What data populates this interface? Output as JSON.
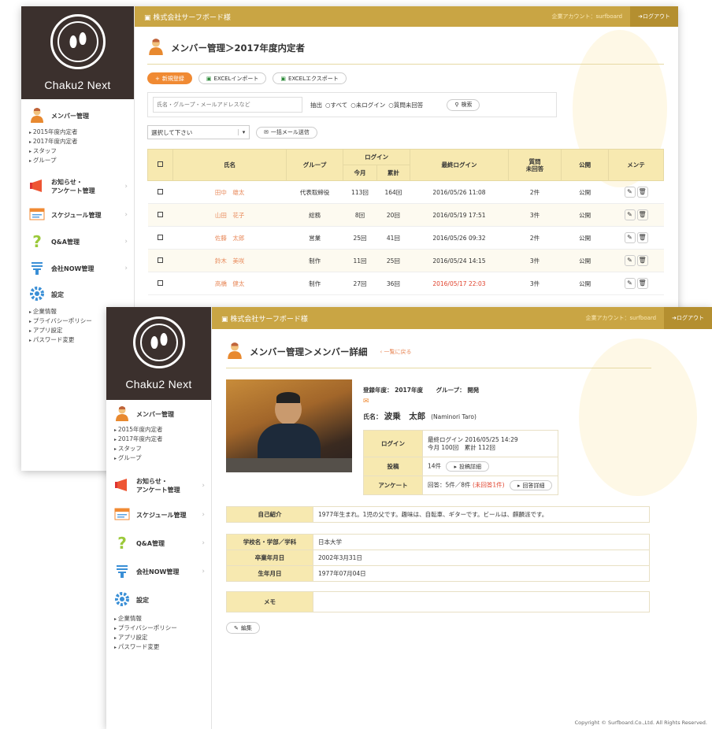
{
  "brand": {
    "app_name": "Chaku2 Next",
    "company": "株式会社サーフボード様",
    "account": "企業アカウント：surfboard",
    "logout": "ログアウト"
  },
  "sidebar": {
    "member_label": "メンバー管理",
    "member_items": [
      "2015年度内定者",
      "2017年度内定者",
      "スタッフ",
      "グループ"
    ],
    "notice_label_1": "お知らせ・",
    "notice_label_2": "アンケート管理",
    "schedule_label": "スケジュール管理",
    "qa_label": "Q&A管理",
    "now_label": "会社NOW管理",
    "settings_label": "設定",
    "settings_items": [
      "企業情報",
      "プライバシーポリシー",
      "アプリ設定",
      "パスワード変更"
    ]
  },
  "list_page": {
    "title": "メンバー管理＞2017年度内定者",
    "btn_new": "新規登録",
    "btn_import": "EXCELインポート",
    "btn_export": "EXCELエクスポート",
    "search_placeholder": "氏名・グループ・メールアドレスなど",
    "filter_label": "抽出",
    "filter_all": "すべて",
    "filter_unlogged": "未ログイン",
    "filter_unanswered": "質問未回答",
    "search_btn": "検索",
    "select_placeholder": "選択して下さい",
    "bulk_mail": "一括メール送信",
    "headers": {
      "name": "氏名",
      "group": "グループ",
      "login": "ログイン",
      "this_month": "今月",
      "total": "累計",
      "last_login": "最終ログイン",
      "unanswered_1": "質問",
      "unanswered_2": "未回答",
      "public": "公開",
      "maint": "メンテ"
    },
    "rows": [
      {
        "name": "田中　雄太",
        "group": "代表取締役",
        "month": "113回",
        "total": "164回",
        "last": "2016/05/26 11:08",
        "unans": "2件",
        "pub": "公開",
        "last_red": false
      },
      {
        "name": "山田　花子",
        "group": "総務",
        "month": "8回",
        "total": "20回",
        "last": "2016/05/19 17:51",
        "unans": "3件",
        "pub": "公開",
        "last_red": false
      },
      {
        "name": "佐藤　太郎",
        "group": "営業",
        "month": "25回",
        "total": "41回",
        "last": "2016/05/26 09:32",
        "unans": "2件",
        "pub": "公開",
        "last_red": false
      },
      {
        "name": "鈴木　美咲",
        "group": "制作",
        "month": "11回",
        "total": "25回",
        "last": "2016/05/24 14:15",
        "unans": "3件",
        "pub": "公開",
        "last_red": false
      },
      {
        "name": "高橋　健太",
        "group": "制作",
        "month": "27回",
        "total": "36回",
        "last": "2016/05/17 22:03",
        "unans": "3件",
        "pub": "公開",
        "last_red": true
      }
    ]
  },
  "detail_page": {
    "title": "メンバー管理＞メンバー詳細",
    "back_link": "一覧に戻る",
    "year_label": "登録年度：",
    "year_value": "2017年度",
    "group_label": "グループ：",
    "group_value": "開発",
    "name_label": "氏名：",
    "name_value": "波乗　太郎",
    "name_en": "(Naminori Taro)",
    "login_label": "ログイン",
    "login_last": "最終ログイン 2016/05/25 14:29",
    "login_counts": "今月 100回　累計 112回",
    "post_label": "投稿",
    "post_count": "14件",
    "post_btn": "投稿詳細",
    "survey_label": "アンケート",
    "survey_value": "回答：5件／8件",
    "survey_unanswered": "(未回答1件)",
    "survey_btn": "回答詳細",
    "intro_label": "自己紹介",
    "intro_value": "1977年生まれ。1児の父です。趣味は、自転車、ギターです。ビールは、麒麟派です。",
    "school_label": "学校名・学部／学科",
    "school_value": "日本大学",
    "grad_label": "卒業年月日",
    "grad_value": "2002年3月31日",
    "birth_label": "生年月日",
    "birth_value": "1977年07月04日",
    "memo_label": "メモ",
    "edit_btn": "編集"
  },
  "footer": {
    "copyright": "Copyright © Surfboard.Co.,Ltd. All Rights Reserved."
  },
  "colors": {
    "gold": "#c9a544",
    "dark_brown": "#3b302d",
    "orange": "#f08a33",
    "header_cream": "#f7e9b0"
  }
}
